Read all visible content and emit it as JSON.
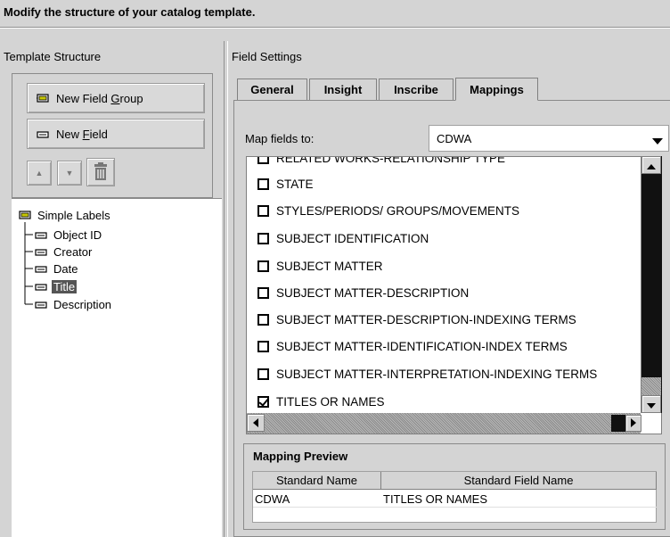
{
  "heading": "Modify the structure of your catalog template.",
  "left_panel": {
    "label": "Template Structure",
    "new_field_group": {
      "before": "New Field ",
      "mnemonic": "G",
      "after": "roup"
    },
    "new_field": {
      "before": "New ",
      "mnemonic": "F",
      "after": "ield"
    },
    "move_up_icon": "triangle-up-icon",
    "move_down_icon": "triangle-down-icon",
    "delete_icon": "trash-icon",
    "tree": {
      "root": "Simple Labels",
      "children": [
        "Object ID",
        "Creator",
        "Date",
        "Title",
        "Description"
      ],
      "selected": "Title"
    }
  },
  "right_panel": {
    "label": "Field Settings",
    "tabs": [
      "General",
      "Insight",
      "Inscribe",
      "Mappings"
    ],
    "active_tab": "Mappings",
    "map_fields_label": "Map fields to:",
    "map_fields_value": "CDWA",
    "field_list": [
      {
        "label": "RELATED WORKS-RELATIONSHIP TYPE",
        "checked": false,
        "partial": true
      },
      {
        "label": "STATE",
        "checked": false
      },
      {
        "label": "STYLES/PERIODS/ GROUPS/MOVEMENTS",
        "checked": false
      },
      {
        "label": "SUBJECT IDENTIFICATION",
        "checked": false
      },
      {
        "label": "SUBJECT MATTER",
        "checked": false
      },
      {
        "label": "SUBJECT MATTER-DESCRIPTION",
        "checked": false
      },
      {
        "label": "SUBJECT MATTER-DESCRIPTION-INDEXING TERMS",
        "checked": false
      },
      {
        "label": "SUBJECT MATTER-IDENTIFICATION-INDEX TERMS",
        "checked": false
      },
      {
        "label": "SUBJECT MATTER-INTERPRETATION-INDEXING TERMS",
        "checked": false
      },
      {
        "label": "TITLES OR NAMES",
        "checked": true
      }
    ],
    "mapping_preview": {
      "legend": "Mapping Preview",
      "columns": [
        "Standard Name",
        "Standard Field Name"
      ],
      "rows": [
        [
          "CDWA",
          "TITLES OR NAMES"
        ]
      ]
    }
  },
  "colors": {
    "background": "#d4d4d4",
    "selection": "#555555"
  }
}
